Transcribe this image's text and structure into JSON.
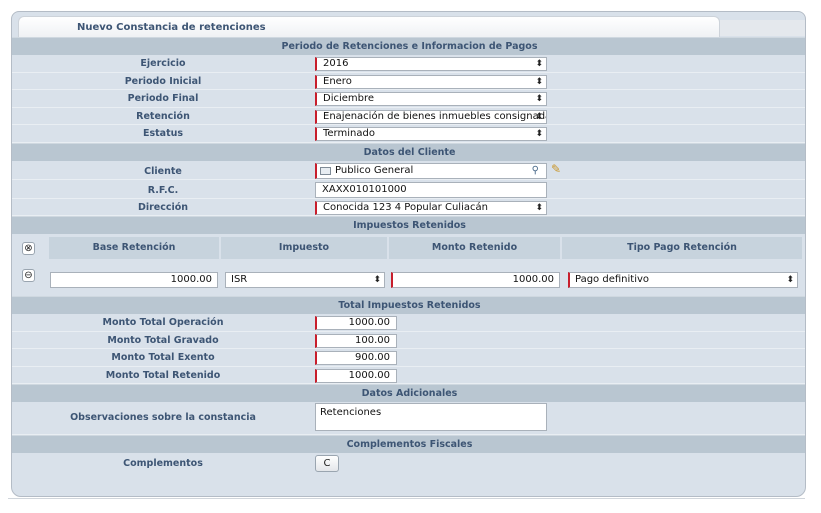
{
  "tab": {
    "title": "Nuevo Constancia de retenciones"
  },
  "sections": {
    "periodo": "Periodo de Retenciones e Informacion de Pagos",
    "cliente": "Datos del Cliente",
    "impuestos": "Impuestos Retenidos",
    "total": "Total Impuestos Retenidos",
    "adicionales": "Datos Adicionales",
    "complementos": "Complementos Fiscales"
  },
  "periodo": {
    "ejercicio": {
      "label": "Ejercicio",
      "value": "2016"
    },
    "inicial": {
      "label": "Periodo Inicial",
      "value": "Enero"
    },
    "final": {
      "label": "Periodo Final",
      "value": "Diciembre"
    },
    "retencion": {
      "label": "Retención",
      "value": "Enajenación de bienes inmuebles consignada e"
    },
    "estatus": {
      "label": "Estatus",
      "value": "Terminado"
    }
  },
  "cliente": {
    "cliente": {
      "label": "Cliente",
      "value": "Publico General"
    },
    "rfc": {
      "label": "R.F.C.",
      "value": "XAXX010101000"
    },
    "direccion": {
      "label": "Dirección",
      "value": "Conocida 123 4 Popular Culiacán"
    }
  },
  "impuestos": {
    "headers": [
      "Base Retención",
      "Impuesto",
      "Monto Retenido",
      "Tipo Pago Retención"
    ],
    "add_icon": "close-circle-icon",
    "remove_icon": "minus-circle-icon",
    "row": {
      "base": "1000.00",
      "impuesto": "ISR",
      "monto": "1000.00",
      "tipo": "Pago definitivo"
    }
  },
  "total": {
    "operacion": {
      "label": "Monto Total Operación",
      "value": "1000.00"
    },
    "gravado": {
      "label": "Monto Total Gravado",
      "value": "100.00"
    },
    "exento": {
      "label": "Monto Total Exento",
      "value": "900.00"
    },
    "retenido": {
      "label": "Monto Total Retenido",
      "value": "1000.00"
    }
  },
  "adicionales": {
    "label": "Observaciones sobre la constancia",
    "value": "Retenciones"
  },
  "complementos": {
    "label": "Complementos",
    "button": "C"
  },
  "colors": {
    "accent_required": "#c81e2c",
    "section_bg": "#b9c6d1",
    "panel_bg": "#d9e1ea"
  }
}
